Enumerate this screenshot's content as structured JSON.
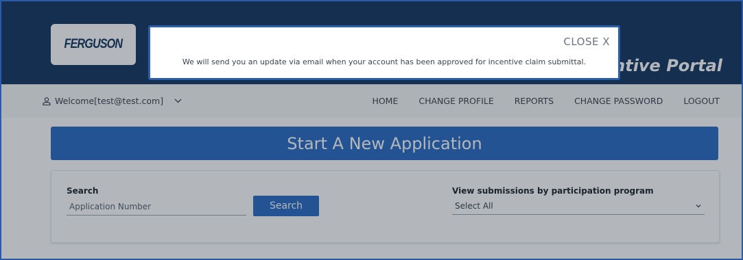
{
  "header": {
    "logo_text": "FERGUSON",
    "portal_title": "centive Portal"
  },
  "nav": {
    "welcome": "Welcome[test@test.com]",
    "links": [
      "HOME",
      "CHANGE PROFILE",
      "REPORTS",
      "CHANGE PASSWORD",
      "LOGOUT"
    ]
  },
  "main": {
    "banner": "Start A New Application",
    "search_label": "Search",
    "search_placeholder": "Application Number",
    "search_button": "Search",
    "filter_label": "View submissions by participation program",
    "filter_value": "Select All"
  },
  "modal": {
    "close_label": "CLOSE X",
    "message": "We will send you an update via email when your account has been approved for incentive claim submittal."
  },
  "colors": {
    "header_bg": "#163760",
    "primary_blue": "#2c6cc4",
    "modal_border": "#2c5fa8"
  }
}
